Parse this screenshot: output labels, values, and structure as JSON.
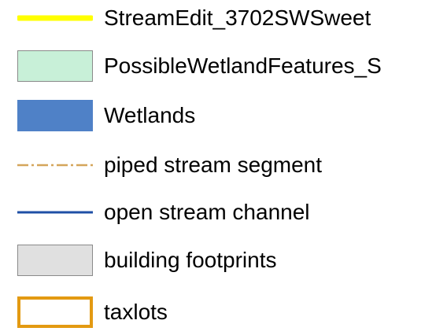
{
  "legend": {
    "items": [
      {
        "label": "StreamEdit_3702SWSweet",
        "symbol": "line",
        "color": "#ffff00",
        "style": "solid-thick"
      },
      {
        "label": "PossibleWetlandFeatures_S",
        "symbol": "fill",
        "fill": "#c8f0d8",
        "stroke": "#8a8a8a"
      },
      {
        "label": "Wetlands",
        "symbol": "fill",
        "fill": "#4f81c7",
        "stroke": "#4f81c7"
      },
      {
        "label": "piped stream segment",
        "symbol": "line",
        "color": "#d4a65a",
        "style": "dash-dot"
      },
      {
        "label": "open stream channel",
        "symbol": "line",
        "color": "#1f4fa6",
        "style": "solid"
      },
      {
        "label": "building footprints",
        "symbol": "fill",
        "fill": "#e0e0e0",
        "stroke": "#8a8a8a"
      },
      {
        "label": "taxlots",
        "symbol": "outline",
        "fill": "#ffffff",
        "stroke": "#e39a12"
      }
    ]
  }
}
